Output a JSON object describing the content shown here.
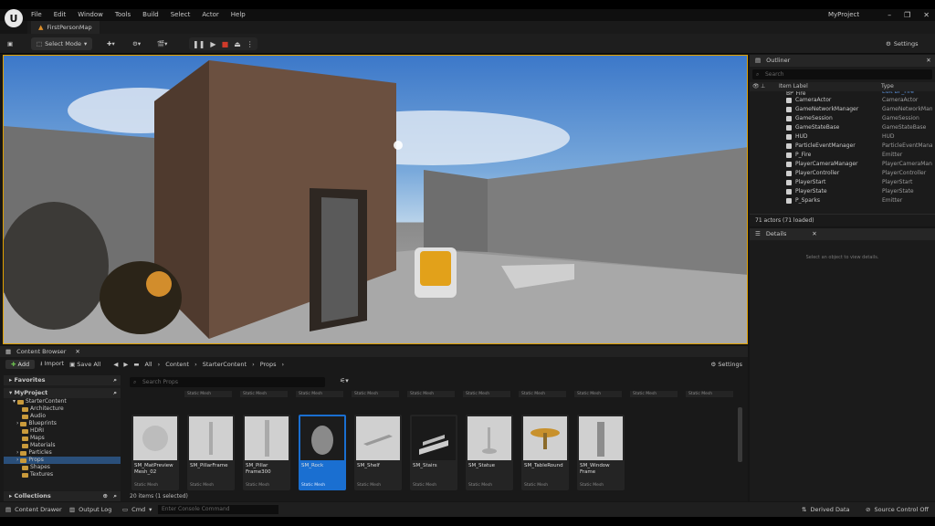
{
  "title_bar": {
    "logo": "U",
    "menus": [
      "File",
      "Edit",
      "Window",
      "Tools",
      "Build",
      "Select",
      "Actor",
      "Help"
    ],
    "project_name": "MyProject"
  },
  "tab": {
    "label": "FirstPersonMap"
  },
  "toolbar": {
    "select_mode": "Select Mode",
    "settings": "Settings"
  },
  "outliner": {
    "title": "Outliner",
    "search_placeholder": "Search",
    "col_label": "Item Label",
    "col_type": "Type",
    "top_row": {
      "label": "BP_Fire",
      "type": "Edit BP_Fire"
    },
    "rows": [
      {
        "label": "CameraActor",
        "type": "CameraActor"
      },
      {
        "label": "GameNetworkManager",
        "type": "GameNetworkManager"
      },
      {
        "label": "GameSession",
        "type": "GameSession"
      },
      {
        "label": "GameStateBase",
        "type": "GameStateBase"
      },
      {
        "label": "HUD",
        "type": "HUD"
      },
      {
        "label": "ParticleEventManager",
        "type": "ParticleEventManager"
      },
      {
        "label": "P_Fire",
        "type": "Emitter"
      },
      {
        "label": "PlayerCameraManager",
        "type": "PlayerCameraManager"
      },
      {
        "label": "PlayerController",
        "type": "PlayerController"
      },
      {
        "label": "PlayerStart",
        "type": "PlayerStart"
      },
      {
        "label": "PlayerState",
        "type": "PlayerState"
      },
      {
        "label": "P_Sparks",
        "type": "Emitter"
      }
    ],
    "count": "71 actors (71 loaded)"
  },
  "details": {
    "title": "Details",
    "empty": "Select an object to view details."
  },
  "content_browser": {
    "title": "Content Browser",
    "add": "Add",
    "import": "Import",
    "save_all": "Save All",
    "crumbs": [
      "All",
      "Content",
      "StarterContent",
      "Props"
    ],
    "settings": "Settings",
    "favorites": "Favorites",
    "project": "MyProject",
    "tree": [
      "StarterContent",
      "Architecture",
      "Audio",
      "Blueprints",
      "HDRI",
      "Maps",
      "Materials",
      "Particles",
      "Props",
      "Shapes",
      "Textures"
    ],
    "collections": "Collections",
    "search_placeholder": "Search Props",
    "prev_type": "Static Mesh",
    "tiles": [
      {
        "name": "SM_MatPreview Mesh_02",
        "type": "Static Mesh"
      },
      {
        "name": "SM_PillarFrame",
        "type": "Static Mesh"
      },
      {
        "name": "SM_Pillar Frame300",
        "type": "Static Mesh"
      },
      {
        "name": "SM_Rock",
        "type": "Static Mesh"
      },
      {
        "name": "SM_Shelf",
        "type": "Static Mesh"
      },
      {
        "name": "SM_Stairs",
        "type": "Static Mesh"
      },
      {
        "name": "SM_Statue",
        "type": "Static Mesh"
      },
      {
        "name": "SM_TableRound",
        "type": "Static Mesh"
      },
      {
        "name": "SM_Window Frame",
        "type": "Static Mesh"
      }
    ],
    "items_status": "20 items (1 selected)"
  },
  "status_bar": {
    "content_drawer": "Content Drawer",
    "output_log": "Output Log",
    "cmd": "Cmd",
    "cmd_placeholder": "Enter Console Command",
    "derived_data": "Derived Data",
    "source_control": "Source Control Off"
  },
  "colors": {
    "accent_yellow": "#e0a000",
    "selection_blue": "#1a6fd1",
    "folder": "#c99a3b",
    "record_red": "#d03a2a"
  }
}
